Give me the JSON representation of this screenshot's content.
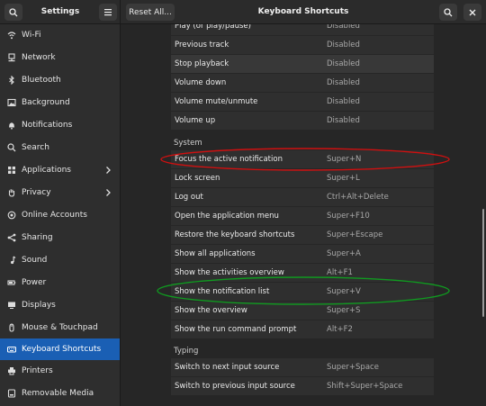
{
  "sidebar": {
    "title": "Settings",
    "items": [
      {
        "label": "Wi-Fi",
        "icon": "wifi-icon"
      },
      {
        "label": "Network",
        "icon": "network-icon"
      },
      {
        "label": "Bluetooth",
        "icon": "bluetooth-icon"
      },
      {
        "label": "Background",
        "icon": "background-icon"
      },
      {
        "label": "Notifications",
        "icon": "bell-icon"
      },
      {
        "label": "Search",
        "icon": "search-icon"
      },
      {
        "label": "Applications",
        "icon": "apps-icon",
        "chevron": true
      },
      {
        "label": "Privacy",
        "icon": "hand-icon",
        "chevron": true
      },
      {
        "label": "Online Accounts",
        "icon": "online-accounts-icon"
      },
      {
        "label": "Sharing",
        "icon": "share-icon"
      },
      {
        "label": "Sound",
        "icon": "music-note-icon"
      },
      {
        "label": "Power",
        "icon": "power-icon"
      },
      {
        "label": "Displays",
        "icon": "display-icon"
      },
      {
        "label": "Mouse & Touchpad",
        "icon": "mouse-icon"
      },
      {
        "label": "Keyboard Shortcuts",
        "icon": "keyboard-icon",
        "selected": true
      },
      {
        "label": "Printers",
        "icon": "printer-icon"
      },
      {
        "label": "Removable Media",
        "icon": "media-icon"
      }
    ]
  },
  "header": {
    "reset_label": "Reset All...",
    "title": "Keyboard Shortcuts"
  },
  "rows_top": [
    {
      "name": "Play (or play/pause)",
      "accel": "Disabled"
    },
    {
      "name": "Previous track",
      "accel": "Disabled"
    },
    {
      "name": "Stop playback",
      "accel": "Disabled"
    },
    {
      "name": "Volume down",
      "accel": "Disabled"
    },
    {
      "name": "Volume mute/unmute",
      "accel": "Disabled"
    },
    {
      "name": "Volume up",
      "accel": "Disabled"
    }
  ],
  "section_system": "System",
  "rows_system": [
    {
      "name": "Focus the active notification",
      "accel": "Super+N"
    },
    {
      "name": "Lock screen",
      "accel": "Super+L"
    },
    {
      "name": "Log out",
      "accel": "Ctrl+Alt+Delete"
    },
    {
      "name": "Open the application menu",
      "accel": "Super+F10"
    },
    {
      "name": "Restore the keyboard shortcuts",
      "accel": "Super+Escape"
    },
    {
      "name": "Show all applications",
      "accel": "Super+A"
    },
    {
      "name": "Show the activities overview",
      "accel": "Alt+F1"
    },
    {
      "name": "Show the notification list",
      "accel": "Super+V"
    },
    {
      "name": "Show the overview",
      "accel": "Super+S"
    },
    {
      "name": "Show the run command prompt",
      "accel": "Alt+F2"
    }
  ],
  "section_typing": "Typing",
  "rows_typing": [
    {
      "name": "Switch to next input source",
      "accel": "Super+Space"
    },
    {
      "name": "Switch to previous input source",
      "accel": "Shift+Super+Space"
    }
  ],
  "colors": {
    "accent": "#1a5fb4",
    "annotation_red": "#d01010",
    "annotation_green": "#109a20"
  }
}
